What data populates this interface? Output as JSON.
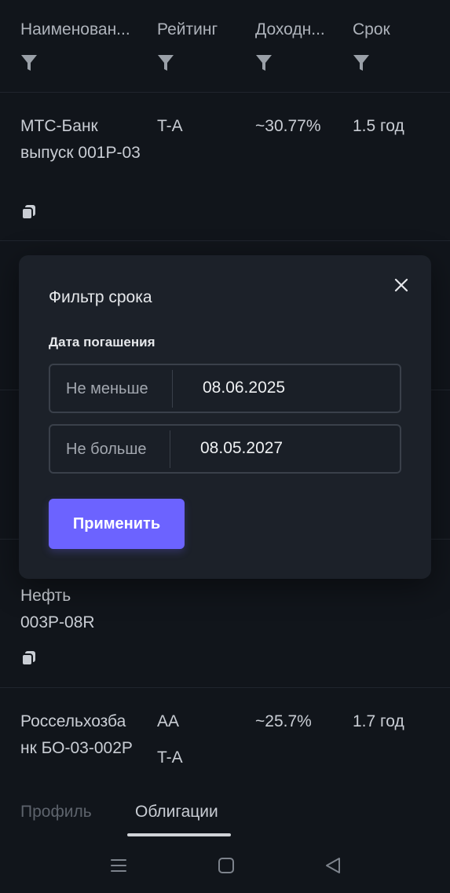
{
  "table": {
    "headers": [
      "Наименован...",
      "Рейтинг",
      "Доходн...",
      "Срок"
    ],
    "rows": [
      {
        "name": "МТС-Банк выпуск 001Р-03",
        "rating": [
          "T-A"
        ],
        "yield": "~30.77%",
        "term": "1.5 год"
      },
      {
        "name": "Нефть 003Р-08R",
        "rating": [],
        "yield": "",
        "term": ""
      },
      {
        "name": "Россельхозба нк БО-03-002Р",
        "rating": [
          "AA",
          "T-A"
        ],
        "yield": "~25.7%",
        "term": "1.7 год"
      }
    ]
  },
  "modal": {
    "title": "Фильтр срока",
    "section_label": "Дата погашения",
    "min_label": "Не меньше",
    "min_value": "08.06.2025",
    "max_label": "Не больше",
    "max_value": "08.05.2027",
    "apply_label": "Применить"
  },
  "tabs": [
    {
      "label": "Профиль",
      "active": false
    },
    {
      "label": "Облигации",
      "active": true
    }
  ],
  "colors": {
    "background": "#11151b",
    "modal": "#1c2129",
    "accent": "#6c63ff"
  },
  "icons": [
    "filter-icon",
    "copy-icon",
    "close-icon",
    "menu-icon",
    "home-icon",
    "back-icon"
  ]
}
